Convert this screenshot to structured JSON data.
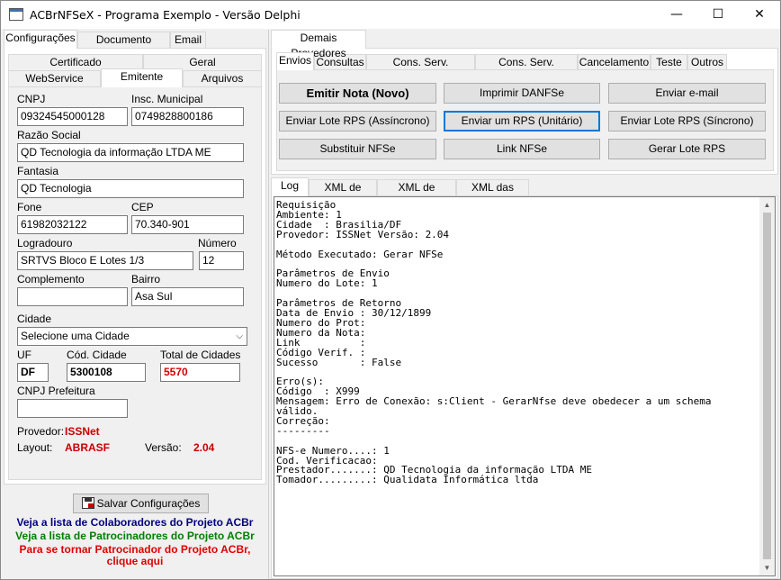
{
  "window": {
    "title": "ACBrNFSeX - Programa Exemplo - Versão Delphi",
    "minimize": "—",
    "maximize": "☐",
    "close": "✕"
  },
  "left_tabs": {
    "config": "Configurações",
    "doc_aux": "Documento Auxiliar",
    "email": "Email"
  },
  "sub_tabs": {
    "certificado": "Certificado",
    "geral": "Geral",
    "webservice": "WebService",
    "emitente": "Emitente",
    "arquivos": "Arquivos"
  },
  "emitente": {
    "cnpj_label": "CNPJ",
    "cnpj": "09324545000128",
    "im_label": "Insc. Municipal",
    "im": "0749828800186",
    "razao_label": "Razão Social",
    "razao": "QD Tecnologia da informação LTDA ME",
    "fantasia_label": "Fantasia",
    "fantasia": "QD Tecnologia",
    "fone_label": "Fone",
    "fone": "61982032122",
    "cep_label": "CEP",
    "cep": "70.340-901",
    "logradouro_label": "Logradouro",
    "logradouro": "SRTVS Bloco E Lotes 1/3",
    "numero_label": "Número",
    "numero": "12",
    "complemento_label": "Complemento",
    "complemento": "",
    "bairro_label": "Bairro",
    "bairro": "Asa Sul",
    "cidade_label": "Cidade",
    "cidade": "Selecione uma Cidade",
    "uf_label": "UF",
    "uf": "DF",
    "cod_cidade_label": "Cód. Cidade",
    "cod_cidade": "5300108",
    "total_cidades_label": "Total de Cidades",
    "total_cidades": "5570",
    "cnpj_pref_label": "CNPJ Prefeitura",
    "cnpj_pref": "",
    "provedor_label": "Provedor:",
    "provedor": "ISSNet",
    "layout_label": "Layout:",
    "layout": "ABRASF",
    "versao_label": "Versão:",
    "versao": "2.04"
  },
  "save_button": "Salvar Configurações",
  "links": {
    "colaboradores": "Veja a lista de Colaboradores do Projeto ACBr",
    "patrocinadores": "Veja a lista de Patrocinadores do Projeto ACBr",
    "patrocinador_1": "Para se tornar Patrocinador do Projeto ACBr,",
    "patrocinador_2": "clique aqui"
  },
  "right_tabs": {
    "demais": "Demais Provedores"
  },
  "action_tabs": {
    "envios": "Envios",
    "consultas": "Consultas",
    "cons_prestados": "Cons. Serv. Prestados",
    "cons_tomados": "Cons. Serv. Tomados",
    "cancelamento": "Cancelamento",
    "teste": "Teste",
    "outros": "Outros"
  },
  "buttons": {
    "emitir": "Emitir Nota (Novo)",
    "imprimir": "Imprimir DANFSe",
    "enviar_email": "Enviar e-mail",
    "lote_assinc": "Enviar Lote RPS (Assíncrono)",
    "um_rps": "Enviar um RPS (Unitário)",
    "lote_sinc": "Enviar Lote RPS (Síncrono)",
    "substituir": "Substituir NFSe",
    "link_nfse": "Link NFSe",
    "gerar_lote": "Gerar Lote RPS"
  },
  "log_tabs": {
    "log": "Log",
    "xml_envio": "XML de Envio",
    "xml_retorno": "XML de Retorno",
    "xml_notas": "XML das Notas"
  },
  "log_text": "Requisição\nAmbiente: 1\nCidade  : Brasilia/DF\nProvedor: ISSNet Versão: 2.04\n\nMétodo Executado: Gerar NFSe\n\nParâmetros de Envio\nNumero do Lote: 1\n\nParâmetros de Retorno\nData de Envio : 30/12/1899\nNumero do Prot:\nNumero da Nota:\nLink          :\nCódigo Verif. :\nSucesso       : False\n\nErro(s):\nCódigo  : X999\nMensagem: Erro de Conexão: s:Client - GerarNfse deve obedecer a um schema válido.\nCorreção:\n---------\n\nNFS-e Numero....: 1\nCod. Verificacao:\nPrestador.......: QD Tecnologia da informação LTDA ME\nTomador.........: Qualidata Informática ltda"
}
